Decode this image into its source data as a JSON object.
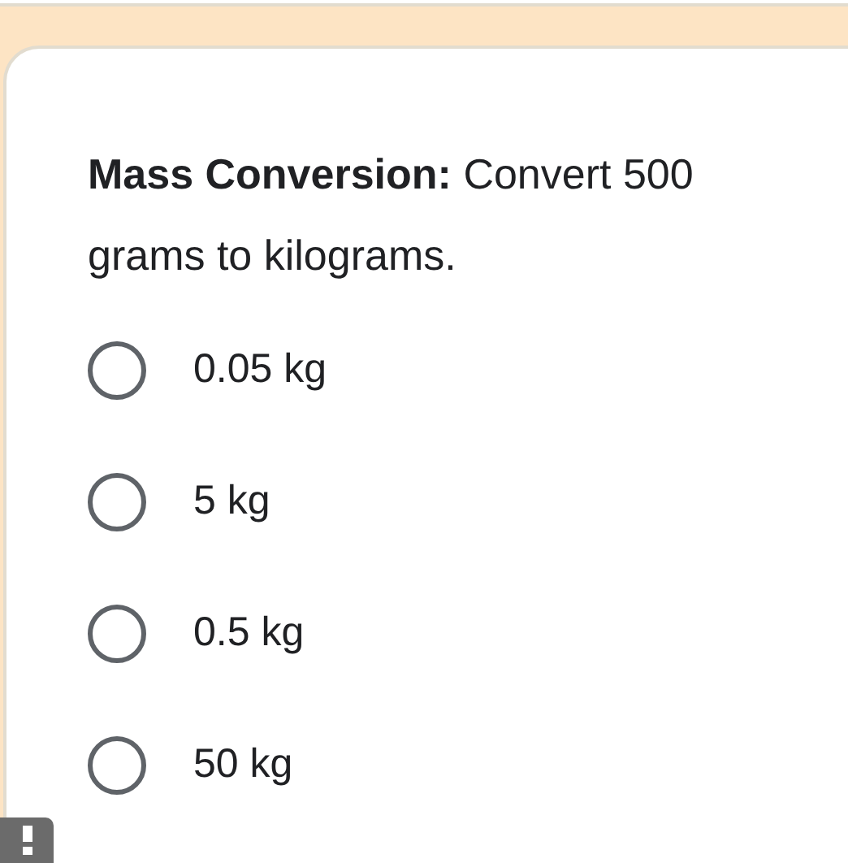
{
  "question": {
    "title": "Mass Conversion:",
    "text": "Convert 500 grams to kilograms."
  },
  "options": [
    {
      "label": "0.05 kg",
      "selected": false
    },
    {
      "label": "5 kg",
      "selected": false
    },
    {
      "label": "0.5 kg",
      "selected": false
    },
    {
      "label": "50 kg",
      "selected": false
    }
  ]
}
